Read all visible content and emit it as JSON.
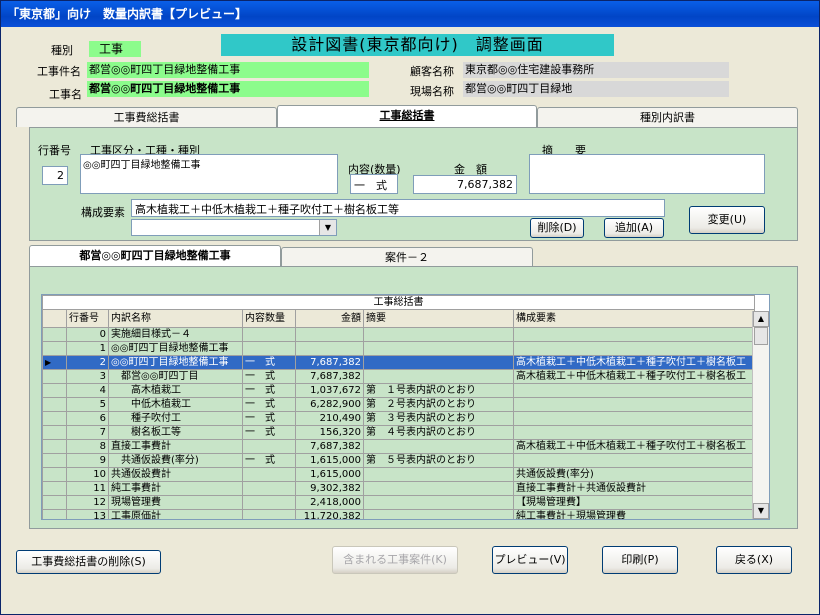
{
  "title": "「東京都」向け　数量内訳書【プレビュー】",
  "header": {
    "kind_label": "種別",
    "kind_value": "工事",
    "screen_title": "設計図書(東京都向け)　調整画面",
    "project_label": "工事件名",
    "project_value": "都営◎◎町四丁目緑地整備工事",
    "work_label": "工事名",
    "work_value": "都営◎◎町四丁目緑地整備工事",
    "client_label": "顧客名称",
    "client_value": "東京都◎◎住宅建設事務所",
    "site_label": "現場名称",
    "site_value": "都営◎◎町四丁目緑地"
  },
  "tabs": [
    "工事費総括書",
    "工事総括書",
    "種別内訳書"
  ],
  "form": {
    "row_no_label": "行番号",
    "row_no_value": "2",
    "category_label": "工事区分・工種・種別",
    "category_value": "◎◎町四丁目緑地整備工事",
    "content_label": "内容(数量)",
    "content_value": "一　式",
    "amount_label": "金　額",
    "amount_value": "7,687,382",
    "summary_label": "摘　　要",
    "summary_value": "",
    "composition_label": "構成要素",
    "composition_value": "高木植栽工＋中低木植栽工＋種子吹付工＋樹名板工等",
    "delete_btn": "削除(D)",
    "add_btn": "追加(A)",
    "change_btn": "変更(U)"
  },
  "subtabs": [
    "都営◎◎町四丁目緑地整備工事",
    "案件－２"
  ],
  "grid": {
    "caption": "工事総括書",
    "columns": [
      "行番号",
      "内訳名称",
      "内容数量",
      "金額",
      "摘要",
      "構成要素"
    ],
    "rows": [
      {
        "no": "0",
        "name": "実施細目様式－４",
        "qty": "",
        "amount": "",
        "note": "",
        "comp": ""
      },
      {
        "no": "1",
        "name": "◎◎町四丁目緑地整備工事",
        "qty": "",
        "amount": "",
        "note": "",
        "comp": ""
      },
      {
        "no": "2",
        "name": "◎◎町四丁目緑地整備工事",
        "qty": "一　式",
        "amount": "7,687,382",
        "note": "",
        "comp": "高木植栽工＋中低木植栽工＋種子吹付工＋樹名板工"
      },
      {
        "no": "3",
        "name": "　都営◎◎町四丁目",
        "qty": "一　式",
        "amount": "7,687,382",
        "note": "",
        "comp": "高木植栽工＋中低木植栽工＋種子吹付工＋樹名板工"
      },
      {
        "no": "4",
        "name": "　　高木植栽工",
        "qty": "一　式",
        "amount": "1,037,672",
        "note": "第　１号表内訳のとおり",
        "comp": ""
      },
      {
        "no": "5",
        "name": "　　中低木植栽工",
        "qty": "一　式",
        "amount": "6,282,900",
        "note": "第　２号表内訳のとおり",
        "comp": ""
      },
      {
        "no": "6",
        "name": "　　種子吹付工",
        "qty": "一　式",
        "amount": "210,490",
        "note": "第　３号表内訳のとおり",
        "comp": ""
      },
      {
        "no": "7",
        "name": "　　樹名板工等",
        "qty": "一　式",
        "amount": "156,320",
        "note": "第　４号表内訳のとおり",
        "comp": ""
      },
      {
        "no": "8",
        "name": "直接工事費計",
        "qty": "",
        "amount": "7,687,382",
        "note": "",
        "comp": "高木植栽工＋中低木植栽工＋種子吹付工＋樹名板工"
      },
      {
        "no": "9",
        "name": "　共通仮設費(率分)",
        "qty": "一　式",
        "amount": "1,615,000",
        "note": "第　５号表内訳のとおり",
        "comp": ""
      },
      {
        "no": "10",
        "name": "共通仮設費計",
        "qty": "",
        "amount": "1,615,000",
        "note": "",
        "comp": "共通仮設費(率分)"
      },
      {
        "no": "11",
        "name": "純工事費計",
        "qty": "",
        "amount": "9,302,382",
        "note": "",
        "comp": "直接工事費計＋共通仮設費計"
      },
      {
        "no": "12",
        "name": "現場管理費",
        "qty": "",
        "amount": "2,418,000",
        "note": "",
        "comp": "【現場管理費】"
      },
      {
        "no": "13",
        "name": "工事原価計",
        "qty": "",
        "amount": "11,720,382",
        "note": "",
        "comp": "純工事費計＋現場管理費"
      }
    ],
    "selected_row_index": 2
  },
  "footer": {
    "delete_summary_btn": "工事費総括書の削除(S)",
    "included_btn": "含まれる工事案件(K)",
    "preview_btn": "プレビュー(V)",
    "print_btn": "印刷(P)",
    "back_btn": "戻る(X)"
  }
}
